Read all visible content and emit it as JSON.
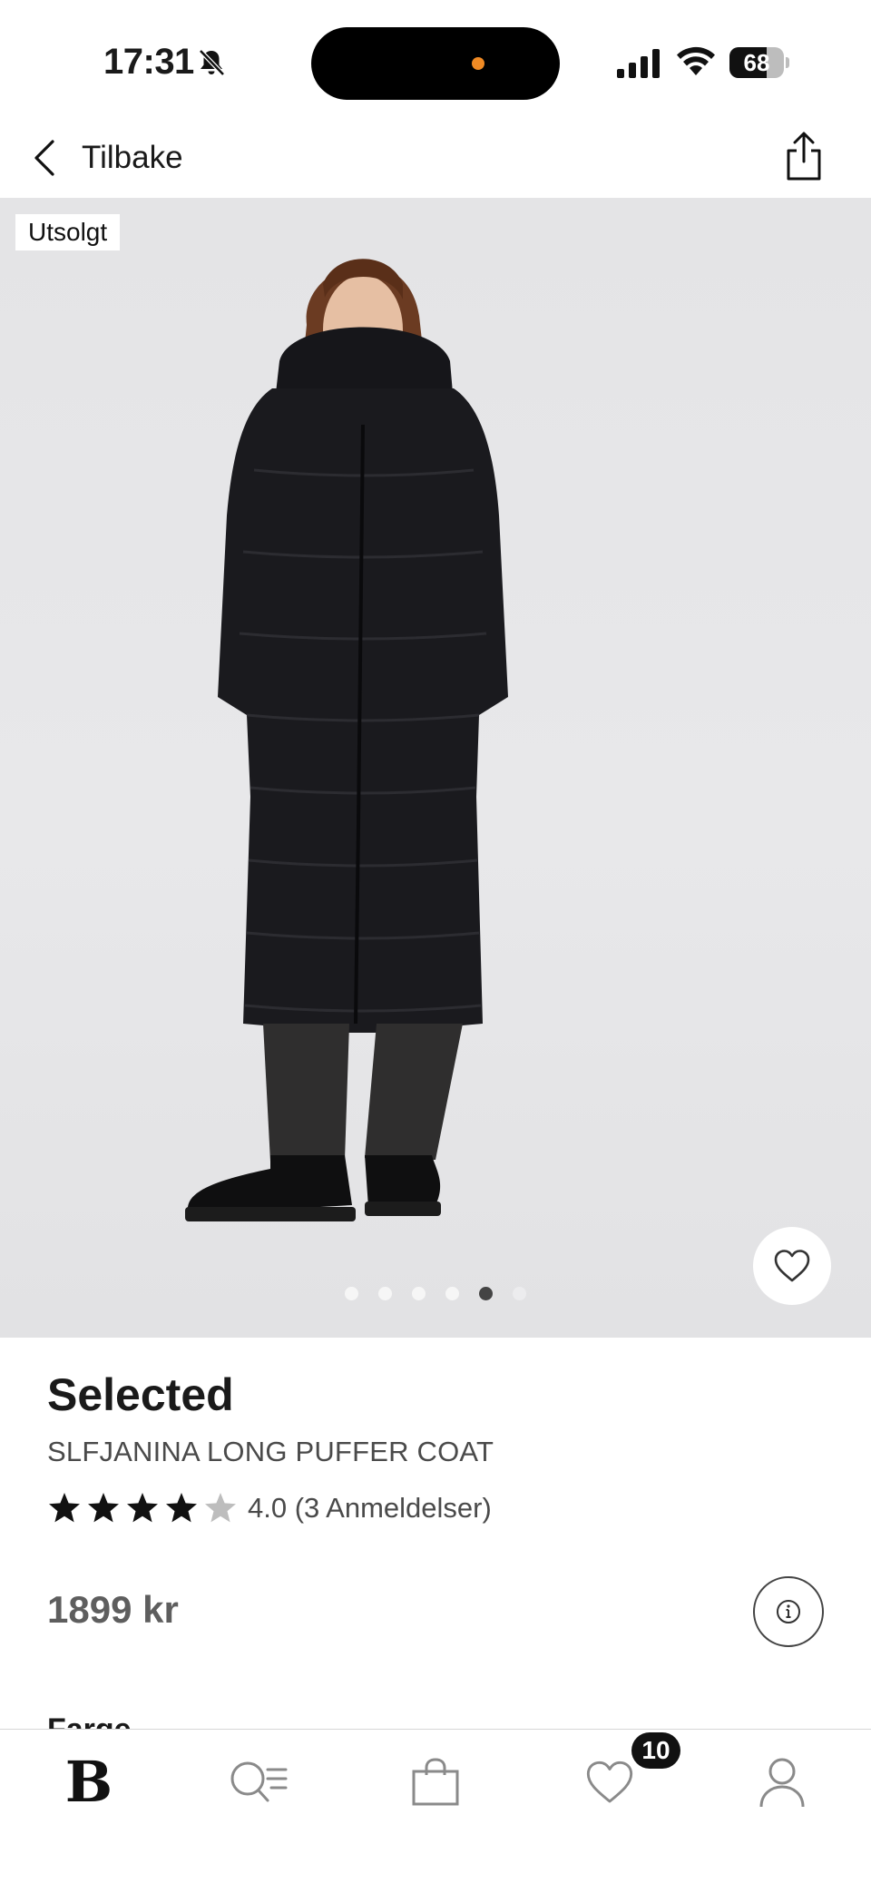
{
  "status_bar": {
    "time": "17:31",
    "battery_level": "68",
    "icons": [
      "bell-muted-icon",
      "signal-icon",
      "wifi-icon",
      "battery-icon"
    ]
  },
  "header": {
    "back_label": "Tilbake",
    "back_icon": "chevron-left-icon",
    "share_icon": "share-icon"
  },
  "product": {
    "sold_badge": "Utsolgt",
    "brand": "Selected",
    "name": "SLFJANINA LONG PUFFER COAT",
    "rating": 4.0,
    "rating_text": "4.0 (3 Anmeldelser)",
    "stars_filled": 4,
    "stars_total": 5,
    "price": "1899 kr",
    "image_count": 6,
    "active_image_index": 4,
    "section_label": "Farge"
  },
  "tab_bar": {
    "items": [
      {
        "name": "home",
        "label": "B",
        "icon": "brand-logo-icon"
      },
      {
        "name": "search",
        "icon": "search-list-icon"
      },
      {
        "name": "bag",
        "icon": "shopping-bag-icon"
      },
      {
        "name": "favorites",
        "icon": "heart-icon",
        "badge": "10"
      },
      {
        "name": "account",
        "icon": "person-icon"
      }
    ]
  },
  "colors": {
    "accent": "#111111",
    "island_dot": "#f08a24",
    "image_bg": "#e6e6e8",
    "star_empty": "#bdbdbd"
  }
}
